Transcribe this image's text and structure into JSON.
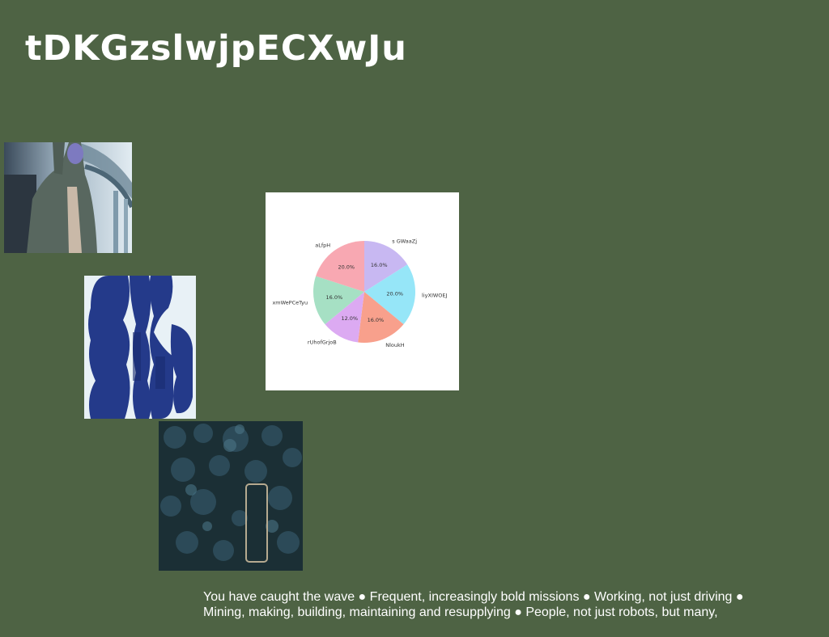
{
  "page": {
    "title": "tDKGzslwjpECXwJu",
    "background": "#4e6344",
    "caption": "You have caught the wave ● Frequent, increasingly bold missions ● Working, not just driving ● Mining, making, building, maintaining and resupplying ● People, not just robots, but many,"
  },
  "images": [
    {
      "name": "photo-man-in-coat",
      "description_icon": "person-photo-icon"
    },
    {
      "name": "photo-blue-wave-pattern",
      "description_icon": "pattern-photo-icon"
    },
    {
      "name": "photo-aerial-forest",
      "description_icon": "aerial-photo-icon"
    }
  ],
  "chart_data": {
    "type": "pie",
    "title": "",
    "slices": [
      {
        "label": "s GWaaZj",
        "value": 16.0,
        "pct": "16.0%",
        "color": "#c8b8f2"
      },
      {
        "label": "liyXIWOEJ",
        "value": 20.0,
        "pct": "20.0%",
        "color": "#96e6f8"
      },
      {
        "label": "NloukH",
        "value": 16.0,
        "pct": "16.0%",
        "color": "#f8a08c"
      },
      {
        "label": "rUhofGrjoB",
        "value": 12.0,
        "pct": "12.0%",
        "color": "#dcaaf2"
      },
      {
        "label": "xmWePCeTyu",
        "value": 16.0,
        "pct": "16.0%",
        "color": "#a6e0c4"
      },
      {
        "label": "aLfpH",
        "value": 20.0,
        "pct": "20.0%",
        "color": "#f8a8b2"
      }
    ],
    "start_angle": 90,
    "direction": "clockwise",
    "legend": "none"
  }
}
